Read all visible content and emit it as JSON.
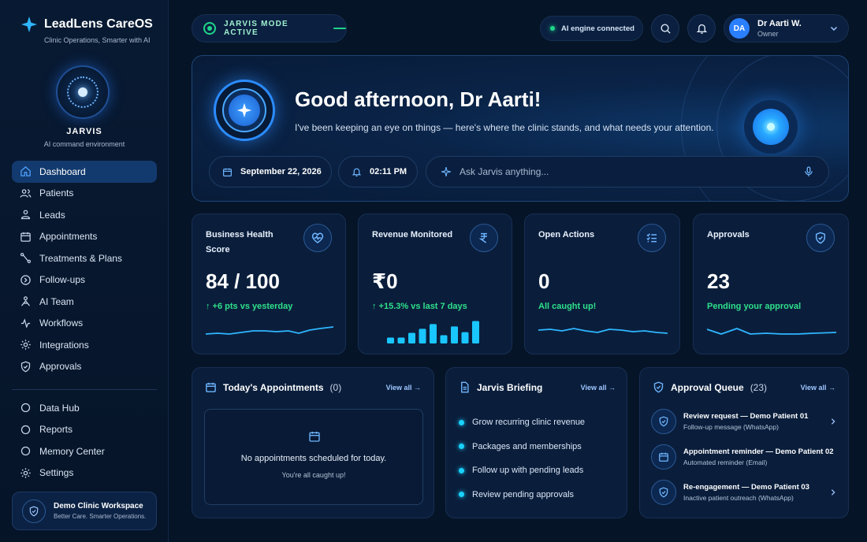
{
  "app": {
    "name": "LeadLens CareOS",
    "tagline": "Clinic Operations, Smarter with AI"
  },
  "jarvis": {
    "name": "JARVIS",
    "subtitle": "AI command environment",
    "mode_label": "JARVIS MODE ACTIVE"
  },
  "sidebar": {
    "items": [
      {
        "label": "Dashboard",
        "icon": "home-icon",
        "active": true
      },
      {
        "label": "Patients",
        "icon": "users-icon"
      },
      {
        "label": "Leads",
        "icon": "lead-icon"
      },
      {
        "label": "Appointments",
        "icon": "calendar-icon"
      },
      {
        "label": "Treatments & Plans",
        "icon": "flow-icon"
      },
      {
        "label": "Follow-ups",
        "icon": "followup-icon"
      },
      {
        "label": "AI Team",
        "icon": "ai-team-icon"
      },
      {
        "label": "Workflows",
        "icon": "workflow-icon"
      },
      {
        "label": "Integrations",
        "icon": "gear-icon"
      },
      {
        "label": "Approvals",
        "icon": "shield-check-icon"
      }
    ],
    "secondary": [
      {
        "label": "Data Hub",
        "icon": "circle-icon"
      },
      {
        "label": "Reports",
        "icon": "circle-icon"
      },
      {
        "label": "Memory Center",
        "icon": "circle-icon"
      },
      {
        "label": "Settings",
        "icon": "gear-icon"
      }
    ],
    "workspace": {
      "title": "Demo Clinic Workspace",
      "subtitle": "Better Care. Smarter Operations."
    }
  },
  "topbar": {
    "ai_status": "AI engine connected",
    "user": {
      "initials": "DA",
      "name": "Dr Aarti W.",
      "role": "Owner"
    }
  },
  "hero": {
    "greeting": "Good afternoon, Dr Aarti!",
    "subtitle": "I've been keeping an eye on things — here's where the clinic stands, and what needs your attention.",
    "date": "September 22, 2026",
    "time": "02:11 PM",
    "ask_placeholder": "Ask Jarvis anything..."
  },
  "cards": [
    {
      "title": "Business Health Score",
      "value": "84 / 100",
      "delta": "↑ +6 pts vs yesterday",
      "icon": "heart-pulse-icon"
    },
    {
      "title": "Revenue Monitored",
      "value": "₹0",
      "delta": "↑ +15.3% vs last 7 days",
      "icon": "rupee-icon",
      "bars": [
        0.25,
        0.25,
        0.45,
        0.62,
        0.82,
        0.35,
        0.72,
        0.48,
        0.95
      ]
    },
    {
      "title": "Open Actions",
      "value": "0",
      "delta": "All caught up!",
      "icon": "checklist-icon"
    },
    {
      "title": "Approvals",
      "value": "23",
      "delta": "Pending your approval",
      "icon": "shield-check-icon"
    }
  ],
  "appointments": {
    "title": "Today's Appointments",
    "count": "(0)",
    "view_all": "View all →",
    "empty_title": "No appointments scheduled for today.",
    "empty_sub": "You're all caught up!"
  },
  "briefing": {
    "title": "Jarvis Briefing",
    "view_all": "View all →",
    "items": [
      "Grow recurring clinic revenue",
      "Packages and memberships",
      "Follow up with pending leads",
      "Review pending approvals"
    ]
  },
  "approval_queue": {
    "title": "Approval Queue",
    "count": "(23)",
    "view_all": "View all →",
    "items": [
      {
        "title": "Review request — Demo Patient 01",
        "sub": "Follow-up message (WhatsApp)",
        "icon": "shield-check-icon"
      },
      {
        "title": "Appointment reminder — Demo Patient 02",
        "sub": "Automated reminder (Email)",
        "icon": "calendar-icon"
      },
      {
        "title": "Re-engagement — Demo Patient 03",
        "sub": "Inactive patient outreach (WhatsApp)",
        "icon": "shield-check-icon"
      }
    ]
  },
  "colors": {
    "accent": "#2a7fff",
    "success": "#2fe08a",
    "cyan": "#19d2ff",
    "background": "#061428"
  }
}
